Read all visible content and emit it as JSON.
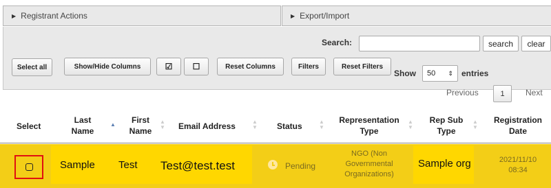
{
  "panels": {
    "registrant_actions": "Registrant Actions",
    "export_import": "Export/Import"
  },
  "search": {
    "label": "Search:",
    "value": "",
    "search_button": "search",
    "clear_button": "clear"
  },
  "toolbar": {
    "select_all": "Select all",
    "show_hide_columns": "Show/Hide Columns",
    "check_all_icon": "☑",
    "uncheck_all_icon": "☐",
    "reset_columns": "Reset Columns",
    "filters": "Filters",
    "reset_filters": "Reset Filters"
  },
  "entries": {
    "show_label": "Show",
    "value": "50",
    "entries_label": "entries"
  },
  "pagination": {
    "previous": "Previous",
    "page": "1",
    "next": "Next"
  },
  "table": {
    "headers": {
      "select": "Select",
      "last_name": [
        "Last",
        "Name"
      ],
      "first_name": [
        "First",
        "Name"
      ],
      "email": "Email Address",
      "status": "Status",
      "representation_type": [
        "Representation",
        "Type"
      ],
      "rep_sub_type": [
        "Rep Sub",
        "Type"
      ],
      "registration_date": [
        "Registration",
        "Date"
      ]
    },
    "rows": [
      {
        "last_name": "Sample",
        "first_name": "Test",
        "email": "Test@test.test",
        "status": "Pending",
        "representation_type": [
          "NGO (Non",
          "Governmental",
          "Organizations)"
        ],
        "rep_sub_type": "Sample org",
        "registration_date": [
          "2021/11/10",
          "08:34"
        ]
      }
    ]
  },
  "colors": {
    "row_highlight": "#f3ce17",
    "cell_highlight": "#ffd700",
    "callout_border": "#e01010",
    "sort_active": "#5b7fb3"
  }
}
